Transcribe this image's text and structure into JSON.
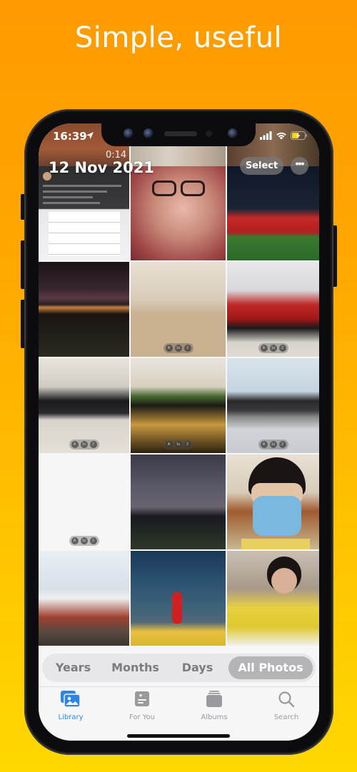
{
  "headline": "Simple, useful",
  "status_bar": {
    "time": "16:39",
    "location_icon": "location-arrow-icon",
    "signal_icon": "cellular-signal-icon",
    "wifi_icon": "wifi-icon",
    "battery_icon": "battery-charging-icon"
  },
  "library": {
    "date_title": "12 Nov 2021",
    "video_duration": "0:14",
    "select_label": "Select",
    "more_label": "•••",
    "live_badges": [
      "A",
      "1x",
      "2"
    ],
    "photos": [
      {
        "name": "photo-chat-screenshot",
        "desc": "screenshot of chat with table"
      },
      {
        "name": "photo-girl-glasses",
        "desc": "selfie of girl with glasses"
      },
      {
        "name": "photo-football-team",
        "desc": "football team in red jerseys"
      },
      {
        "name": "photo-city-night",
        "desc": "city skyline at night"
      },
      {
        "name": "photo-mall-corridor",
        "desc": "mall corridor checkered floor"
      },
      {
        "name": "photo-red-car-showroom",
        "desc": "red car with bow in showroom"
      },
      {
        "name": "photo-black-car-mall",
        "desc": "black car in mall"
      },
      {
        "name": "photo-koi-pond",
        "desc": "indoor koi pond"
      },
      {
        "name": "photo-horse-statue",
        "desc": "horse statue plaza"
      },
      {
        "name": "photo-building-statue",
        "desc": "apartment building with statue"
      },
      {
        "name": "photo-night-road",
        "desc": "night road view"
      },
      {
        "name": "photo-boy-mask",
        "desc": "boy wearing blue mask"
      },
      {
        "name": "photo-city-street",
        "desc": "city street buildings"
      },
      {
        "name": "photo-christmas-decor",
        "desc": "girl at christmas decoration"
      },
      {
        "name": "photo-girl-yellow",
        "desc": "girl in yellow shirt"
      }
    ]
  },
  "segment": {
    "items": [
      "Years",
      "Months",
      "Days",
      "All Photos"
    ],
    "active": "All Photos"
  },
  "tabbar": {
    "items": [
      {
        "label": "Library",
        "icon": "photo-library-icon",
        "active": true
      },
      {
        "label": "For You",
        "icon": "for-you-icon",
        "active": false
      },
      {
        "label": "Albums",
        "icon": "albums-icon",
        "active": false
      },
      {
        "label": "Search",
        "icon": "search-icon",
        "active": false
      }
    ]
  },
  "colors": {
    "accent": "#2c86e6",
    "background_top": "#ff9a00",
    "background_bottom": "#ffd800"
  }
}
